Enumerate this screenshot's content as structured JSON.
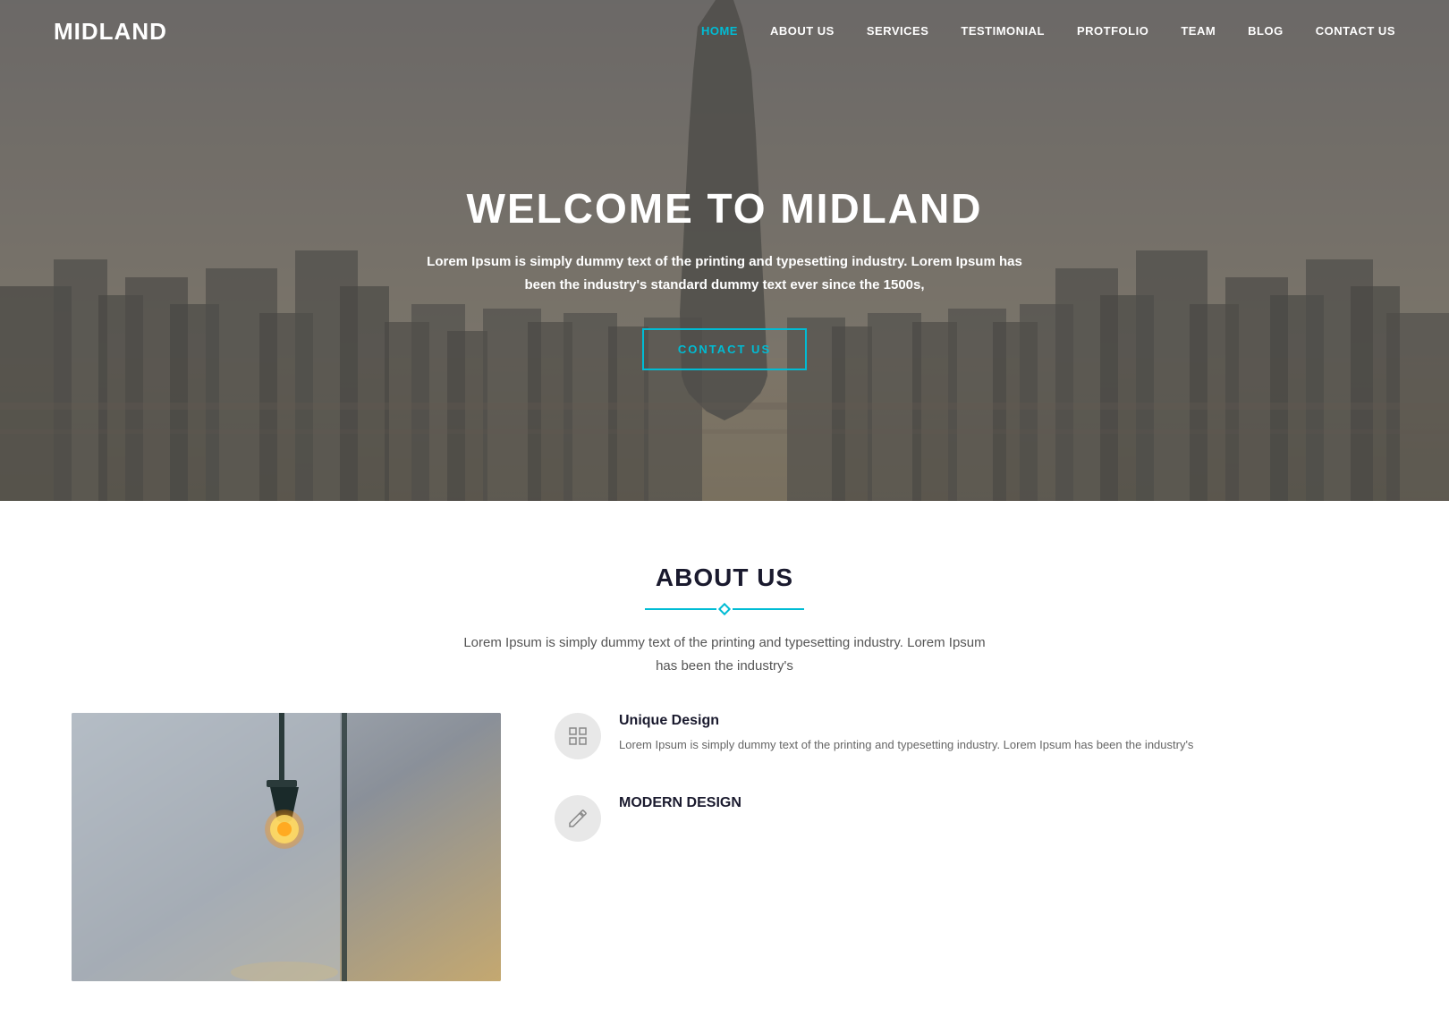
{
  "brand": "MIDLAND",
  "nav": {
    "links": [
      {
        "label": "HOME",
        "active": true
      },
      {
        "label": "ABOUT US",
        "active": false
      },
      {
        "label": "SERVICES",
        "active": false
      },
      {
        "label": "TESTIMONIAL",
        "active": false
      },
      {
        "label": "PROTFOLIO",
        "active": false
      },
      {
        "label": "TEAM",
        "active": false
      },
      {
        "label": "BLOG",
        "active": false
      },
      {
        "label": "CONTACT US",
        "active": false
      }
    ]
  },
  "hero": {
    "title": "WELCOME TO MIDLAND",
    "subtitle": "Lorem Ipsum is simply dummy text of the printing and typesetting industry. Lorem Ipsum has been the industry's standard dummy text ever since the 1500s,",
    "cta_label": "CONTACT US"
  },
  "about": {
    "section_title": "ABOUT US",
    "section_desc": "Lorem Ipsum is simply dummy text of the printing and typesetting industry. Lorem Ipsum has been the industry's",
    "features": [
      {
        "title": "Unique Design",
        "desc": "Lorem Ipsum is simply dummy text of the printing and typesetting industry. Lorem Ipsum has been the industry's"
      },
      {
        "title": "MODERN DESIGN",
        "desc": ""
      }
    ]
  }
}
